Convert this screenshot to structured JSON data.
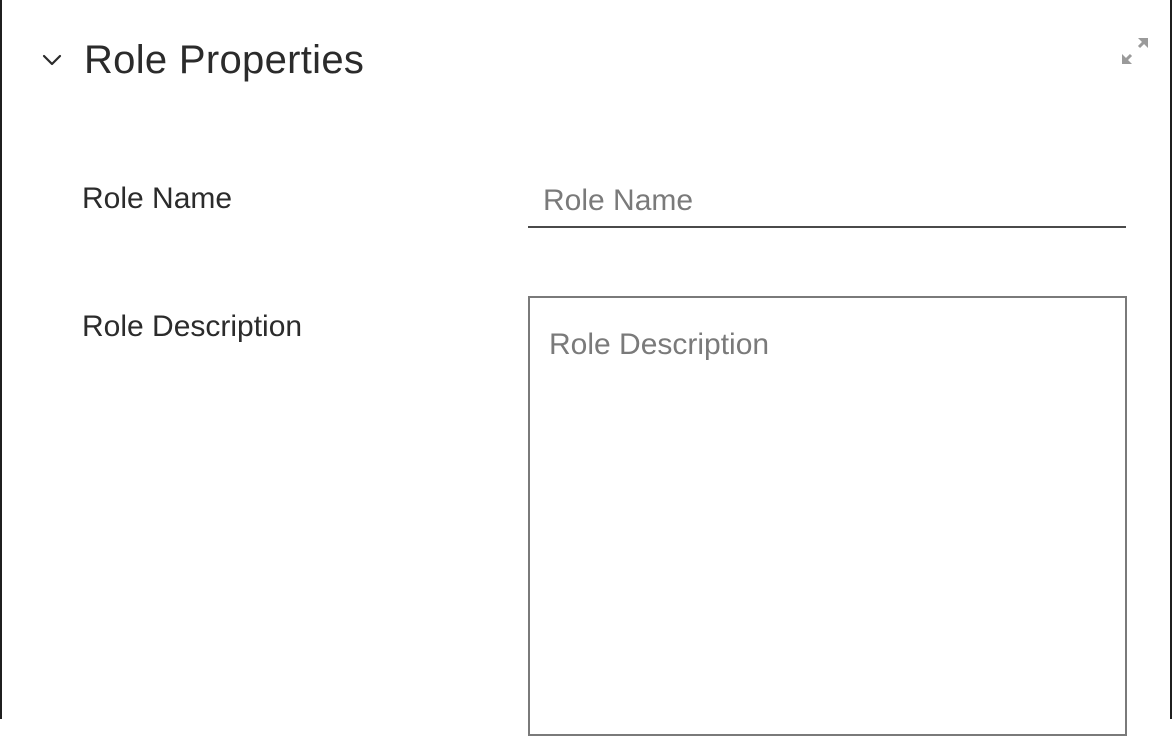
{
  "panel": {
    "title": "Role Properties",
    "collapse_icon": "chevron-down-icon",
    "expand_icon": "expand-arrows-icon"
  },
  "form": {
    "role_name": {
      "label": "Role Name",
      "placeholder": "Role Name",
      "value": ""
    },
    "role_description": {
      "label": "Role Description",
      "placeholder": "Role Description",
      "value": ""
    }
  },
  "colors": {
    "text": "#2b2b2b",
    "placeholder": "#7a7a7a",
    "border": "#1f1f1f",
    "icon": "#9a9a9a"
  }
}
